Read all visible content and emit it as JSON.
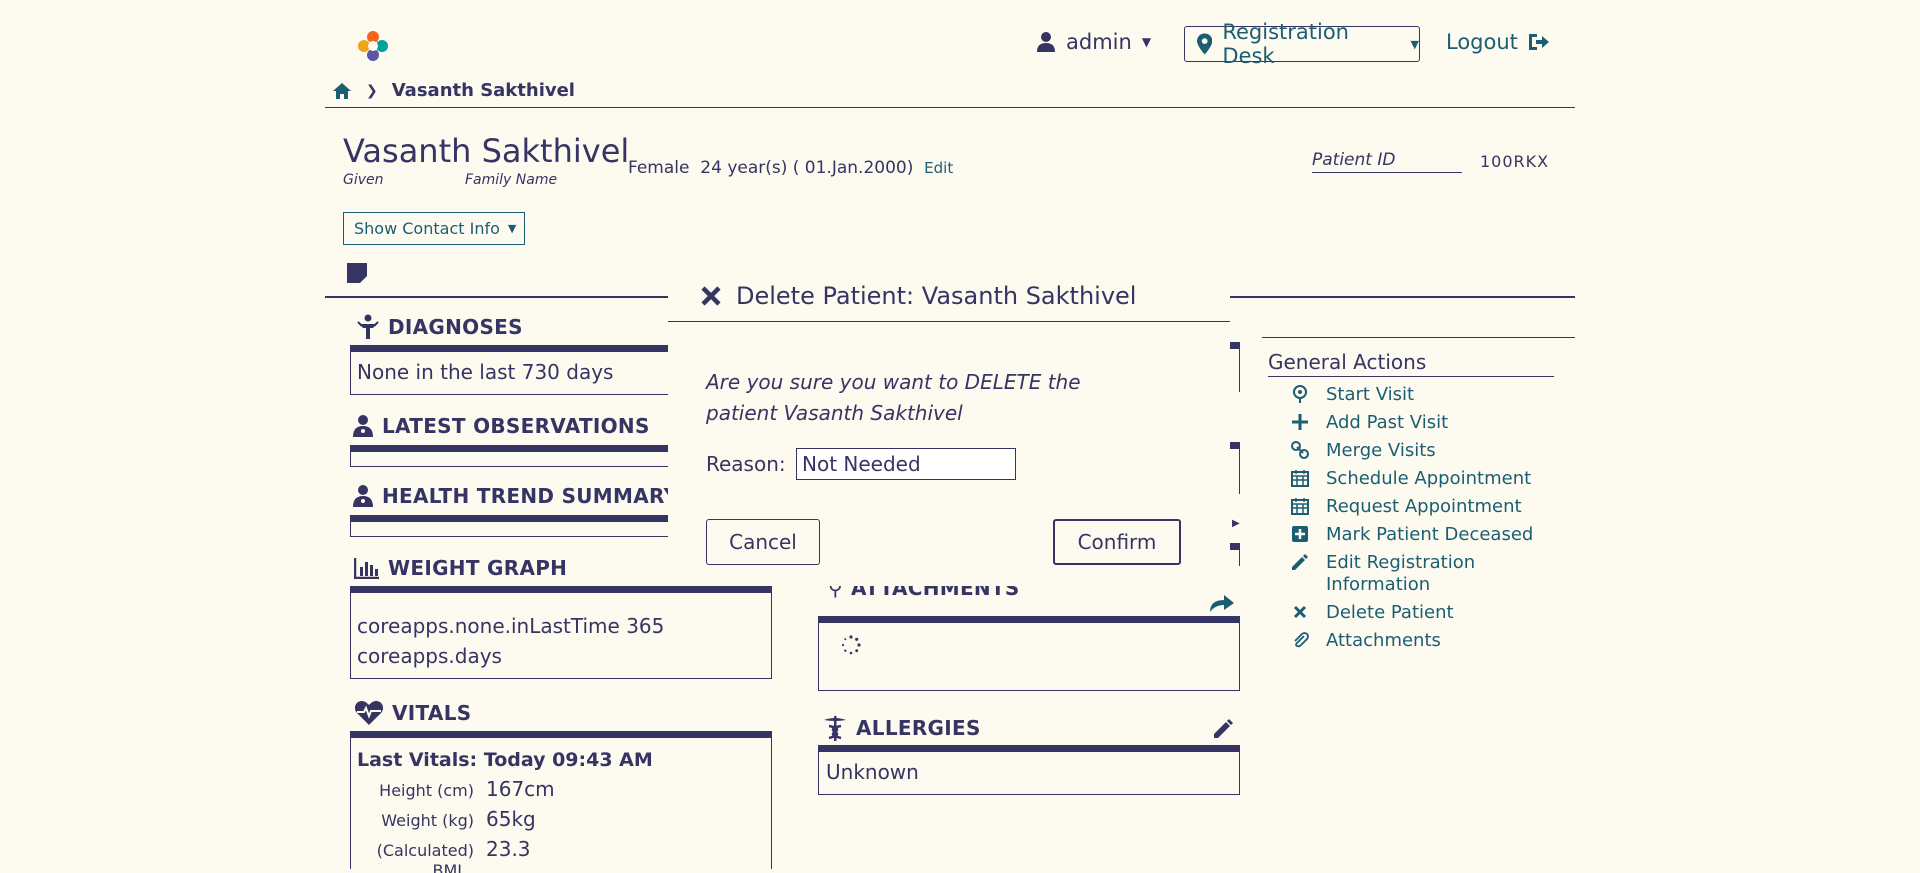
{
  "header": {
    "logo_text": "OpenMRS",
    "user": "admin",
    "location": "Registration Desk",
    "logout": "Logout"
  },
  "breadcrumb": {
    "current": "Vasanth Sakthivel"
  },
  "patient": {
    "name": "Vasanth Sakthivel",
    "given_label": "Given",
    "family_label": "Family Name",
    "gender": "Female",
    "age": "24 year(s) ( 01.Jan.2000)",
    "edit": "Edit",
    "id_label": "Patient ID",
    "id_value": "100RKX",
    "contact_btn": "Show Contact Info"
  },
  "widgets": {
    "diagnoses": {
      "title": "DIAGNOSES",
      "body": "None in the last 730 days"
    },
    "observations": {
      "title": "LATEST OBSERVATIONS"
    },
    "trend": {
      "title": "HEALTH TREND SUMMARY"
    },
    "weight": {
      "title": "WEIGHT GRAPH",
      "line1": "coreapps.none.inLastTime 365",
      "line2": "coreapps.days"
    },
    "vitals": {
      "title": "VITALS",
      "last": "Last Vitals: Today 09:43 AM",
      "rows": [
        {
          "k": "Height (cm)",
          "v": "167cm"
        },
        {
          "k": "Weight (kg)",
          "v": "65kg"
        },
        {
          "k": "(Calculated)",
          "v": "23.3"
        }
      ],
      "bmi_cut": "BMI"
    },
    "attachments": {
      "title": "ATTACHMENTS"
    },
    "allergies": {
      "title": "ALLERGIES",
      "body": "Unknown"
    }
  },
  "general_actions": {
    "title": "General Actions",
    "items": [
      {
        "label": "Start Visit",
        "icon": "map-pin-icon"
      },
      {
        "label": "Add Past Visit",
        "icon": "plus-icon"
      },
      {
        "label": "Merge Visits",
        "icon": "link-icon"
      },
      {
        "label": "Schedule Appointment",
        "icon": "calendar-icon"
      },
      {
        "label": "Request Appointment",
        "icon": "calendar-icon"
      },
      {
        "label": "Mark Patient Deceased",
        "icon": "plus-square-icon"
      },
      {
        "label": "Edit Registration Information",
        "icon": "pencil-icon"
      },
      {
        "label": "Delete Patient",
        "icon": "close-icon"
      },
      {
        "label": "Attachments",
        "icon": "paperclip-icon"
      }
    ]
  },
  "modal": {
    "title": "Delete Patient: Vasanth Sakthivel",
    "question": "Are you sure you want to DELETE the patient Vasanth Sakthivel",
    "reason_label": "Reason:",
    "reason_value": "Not Needed",
    "cancel": "Cancel",
    "confirm": "Confirm"
  },
  "colors": {
    "background": "#fdfaf0",
    "text": "#363463",
    "link": "#1b5e73"
  }
}
